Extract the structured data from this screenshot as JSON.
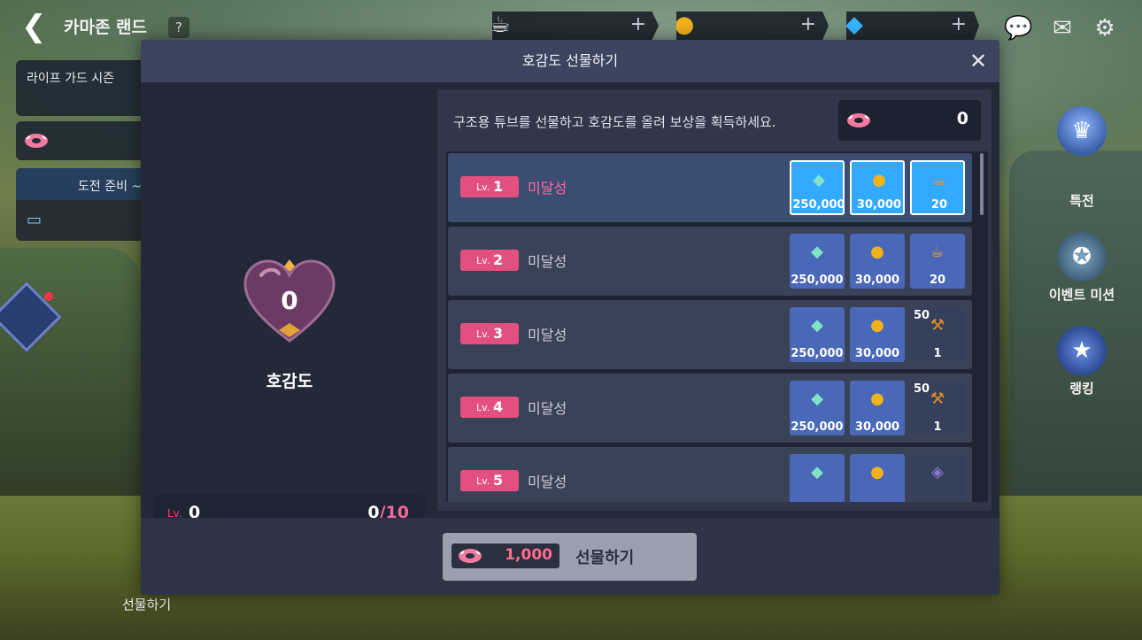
{
  "topbar": {
    "title": "카마존 랜드",
    "help": "?",
    "currencies": [
      {
        "icon": "coffee-icon",
        "plus": "+"
      },
      {
        "icon": "coin-icon",
        "plus": "+"
      },
      {
        "icon": "diamond-icon",
        "plus": "+"
      }
    ]
  },
  "left_panel": {
    "season_label": "라이프 가드 시즌",
    "challenge_label": "도전 준비 ~"
  },
  "side_menu": {
    "item1": "특전",
    "item2": "이벤트 미션",
    "item3": "랭킹"
  },
  "modal": {
    "title": "호감도 선물하기",
    "affinity_value": "0",
    "affinity_label": "호감도",
    "level_prefix": "Lv.",
    "level": "0",
    "progress_current": "0",
    "progress_sep": "/",
    "progress_max": "10",
    "progress_fraction": 0,
    "info_text": "구조용 튜브를 선물하고 호감도를 올려 보상을 획득하세요.",
    "tube_count": "0",
    "rows": [
      {
        "lv": "Lv.",
        "n": "1",
        "status": "미달성",
        "rewards": [
          {
            "icon": "crystal-icon",
            "amount": "250,000",
            "top": ""
          },
          {
            "icon": "coin-icon",
            "amount": "30,000",
            "top": ""
          },
          {
            "icon": "coffee-icon",
            "amount": "20",
            "top": ""
          }
        ]
      },
      {
        "lv": "Lv.",
        "n": "2",
        "status": "미달성",
        "rewards": [
          {
            "icon": "crystal-icon",
            "amount": "250,000",
            "top": ""
          },
          {
            "icon": "coin-icon",
            "amount": "30,000",
            "top": ""
          },
          {
            "icon": "coffee-icon",
            "amount": "20",
            "top": ""
          }
        ]
      },
      {
        "lv": "Lv.",
        "n": "3",
        "status": "미달성",
        "rewards": [
          {
            "icon": "crystal-icon",
            "amount": "250,000",
            "top": ""
          },
          {
            "icon": "coin-icon",
            "amount": "30,000",
            "top": ""
          },
          {
            "icon": "hammer-icon",
            "amount": "1",
            "top": "50"
          }
        ]
      },
      {
        "lv": "Lv.",
        "n": "4",
        "status": "미달성",
        "rewards": [
          {
            "icon": "crystal-icon",
            "amount": "250,000",
            "top": ""
          },
          {
            "icon": "coin-icon",
            "amount": "30,000",
            "top": ""
          },
          {
            "icon": "hammer-icon",
            "amount": "1",
            "top": "50"
          }
        ]
      },
      {
        "lv": "Lv.",
        "n": "5",
        "status": "미달성",
        "rewards": [
          {
            "icon": "crystal-icon",
            "amount": "",
            "top": ""
          },
          {
            "icon": "coin-icon",
            "amount": "",
            "top": ""
          },
          {
            "icon": "cube-icon",
            "amount": "",
            "top": ""
          }
        ]
      }
    ],
    "gift_cost": "1,000",
    "gift_label": "선물하기"
  },
  "bottom_left_label": "선물하기",
  "colors": {
    "accent_pink": "#e3507f",
    "active_blue": "#33a9ff",
    "modal_bg": "#232937"
  }
}
